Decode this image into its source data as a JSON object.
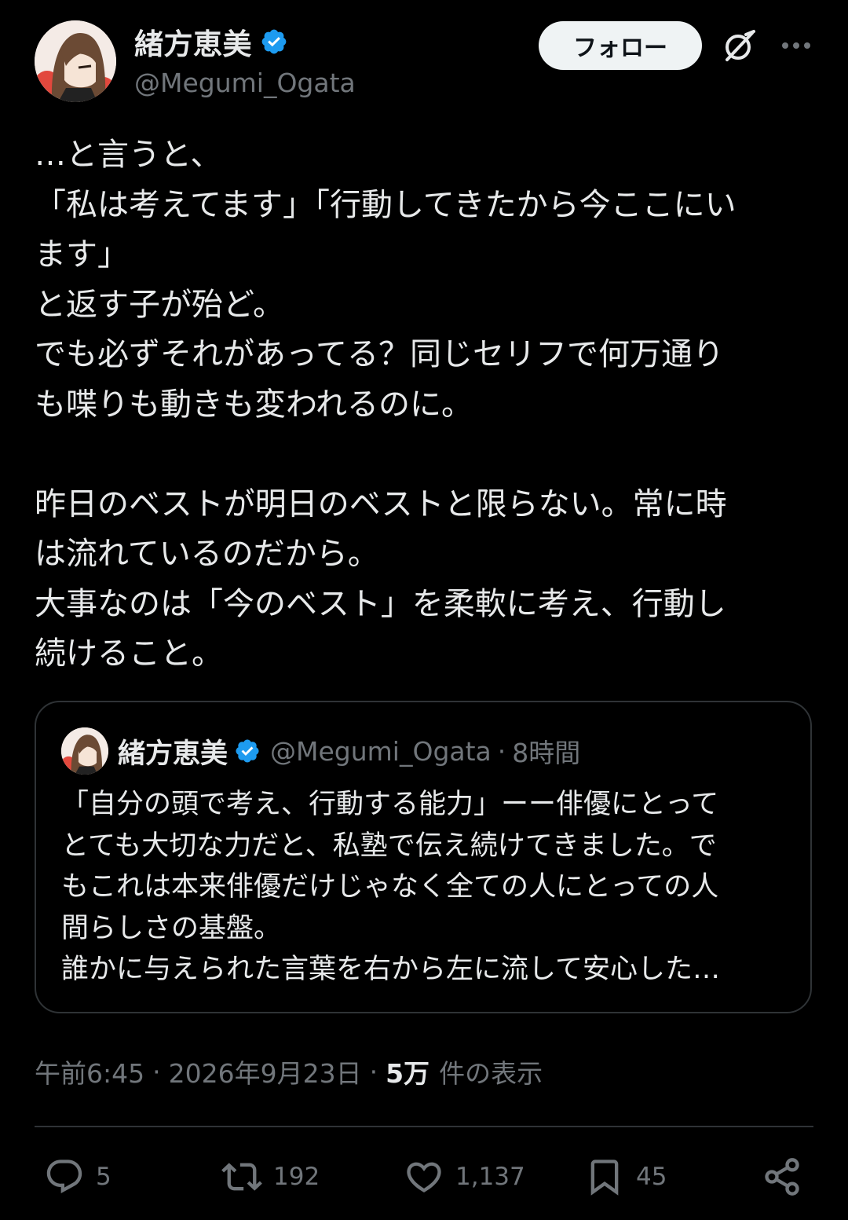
{
  "author": {
    "display_name": "緒方恵美",
    "handle": "@Megumi_Ogata",
    "verified": true
  },
  "header": {
    "follow_label": "フォロー",
    "grok_icon": "grok-icon",
    "more_icon": "more-icon"
  },
  "tweet": {
    "text": "…と言うと、\n「私は考えてます」「行動してきたから今ここにい\nます」\nと返す子が殆ど。\nでも必ずそれがあってる？同じセリフで何万通り\nも喋りも動きも変われるのに。\n\n昨日のベストが明日のベストと限らない。常に時\nは流れているのだから。\n大事なのは「今のベスト」を柔軟に考え、行動し\n続けること。"
  },
  "quote": {
    "display_name": "緒方恵美",
    "handle": "@Megumi_Ogata",
    "separator": "·",
    "time": "8時間",
    "text": "「自分の頭で考え、行動する能力」ーー俳優にとって\nとても大切な力だと、私塾で伝え続けてきました。で\nもこれは本来俳優だけじゃなく全ての人にとっての人\n間らしさの基盤。\n誰かに与えられた言葉を右から左に流して安心した…"
  },
  "meta": {
    "time": "午前6:45",
    "dot": "·",
    "date": "2026年9月23日",
    "views_count": "5万",
    "views_label": "件の表示"
  },
  "actions": {
    "replies": "5",
    "retweets": "192",
    "likes": "1,137",
    "bookmarks": "45"
  },
  "colors": {
    "background": "#000000",
    "text_primary": "#e7e9ea",
    "text_secondary": "#71767b",
    "border": "#2f3336",
    "verified_blue": "#1d9bf0"
  }
}
